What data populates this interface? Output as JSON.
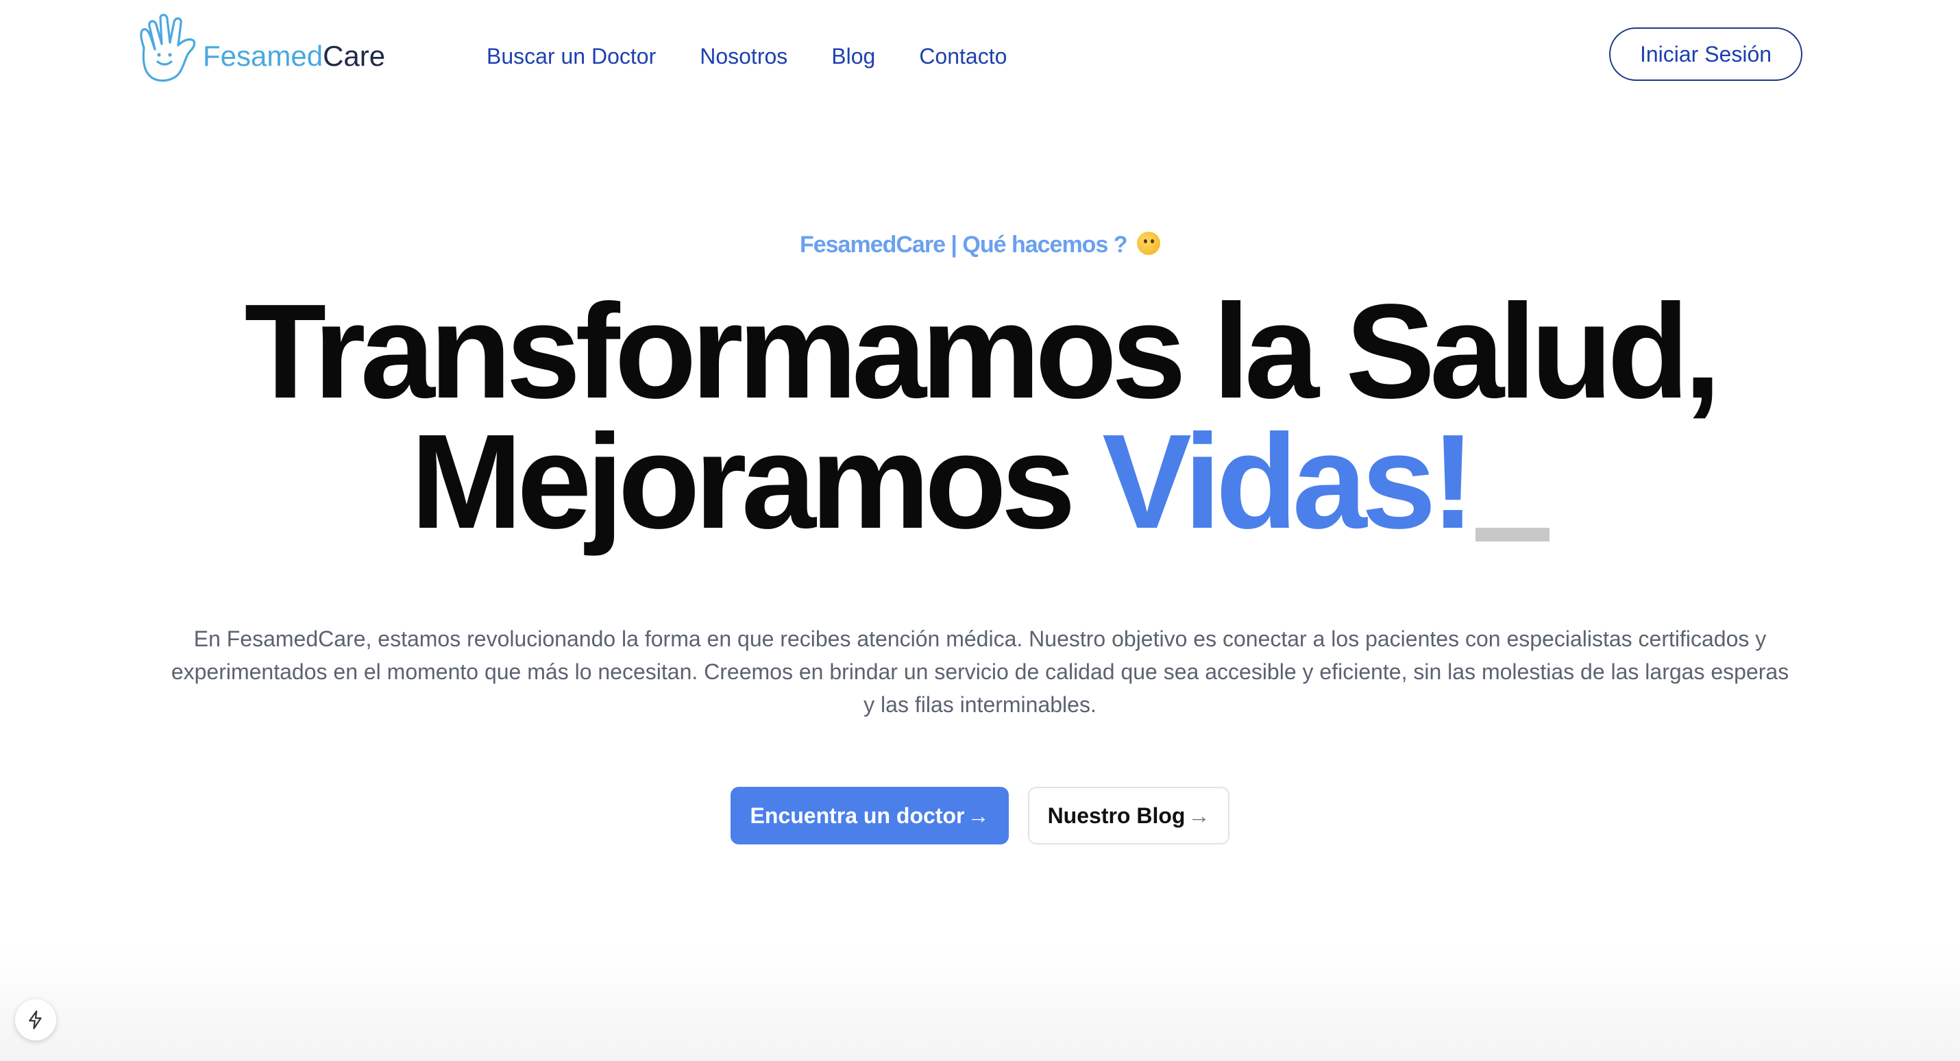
{
  "header": {
    "logo": {
      "part1": "Fesamed",
      "part2": "Care",
      "icon": "waving-hand-smile-icon",
      "colors": {
        "part1": "#4aa8e0",
        "part2": "#1e2a4a"
      }
    },
    "nav": [
      {
        "label": "Buscar un Doctor"
      },
      {
        "label": "Nosotros"
      },
      {
        "label": "Blog"
      },
      {
        "label": "Contacto"
      }
    ],
    "login_label": "Iniciar Sesión"
  },
  "hero": {
    "eyebrow": "FesamedCare | Qué hacemos ?",
    "eyebrow_emoji": "thinking-face-icon",
    "headline_line1": "Transformamos la Salud,",
    "headline_line2_prefix": "Mejoramos ",
    "headline_line2_accent": "Vidas!",
    "description": "En FesamedCare, estamos revolucionando la forma en que recibes atención médica. Nuestro objetivo es conectar a los pacientes con especialistas certificados y experimentados en el momento que más lo necesitan. Creemos en brindar un servicio de calidad que sea accesible y eficiente, sin las molestias de las largas esperas y las filas interminables.",
    "cta_primary": "Encuentra un doctor",
    "cta_secondary": "Nuestro Blog",
    "arrow": "→"
  },
  "colors": {
    "accent": "#4b7fea",
    "nav_link": "#1e40af",
    "eyebrow": "#6aa0ee"
  },
  "dev_badge_icon": "lightning-bolt-icon"
}
